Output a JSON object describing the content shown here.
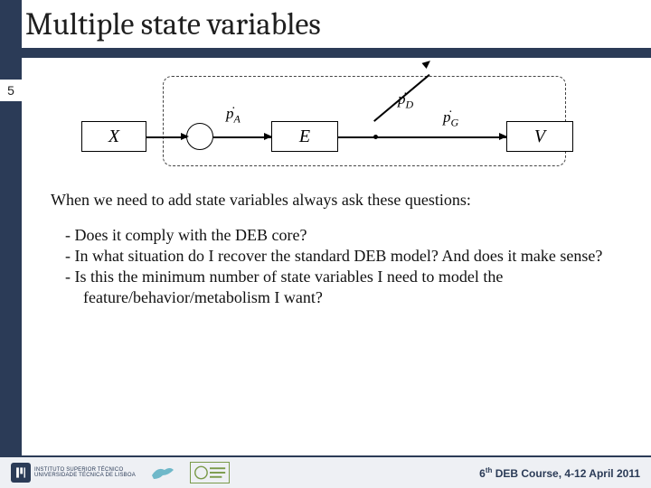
{
  "title": "Multiple state variables",
  "slide_number": "5",
  "diagram": {
    "box_x": "X",
    "box_e": "E",
    "box_v": "V",
    "label_pa_base": "p",
    "label_pa_sub": "A",
    "label_pd_base": "p",
    "label_pd_sub": "D",
    "label_pg_base": "p",
    "label_pg_sub": "G"
  },
  "body": {
    "lead": "When we need to add state variables always ask these questions:",
    "b1": "-    Does it comply with the DEB core?",
    "b2": "-    In what situation do I recover the standard DEB model? And does it make sense?",
    "b3": "-    Is this the minimum number of state variables I need to model the feature/behavior/metabolism I want?"
  },
  "footer": {
    "logo1_line1": "INSTITUTO SUPERIOR TÉCNICO",
    "logo1_line2": "Universidade Técnica de Lisboa",
    "course_prefix": "6",
    "course_ordinal": "th",
    "course_rest": " DEB Course, 4-12 April 2011"
  }
}
